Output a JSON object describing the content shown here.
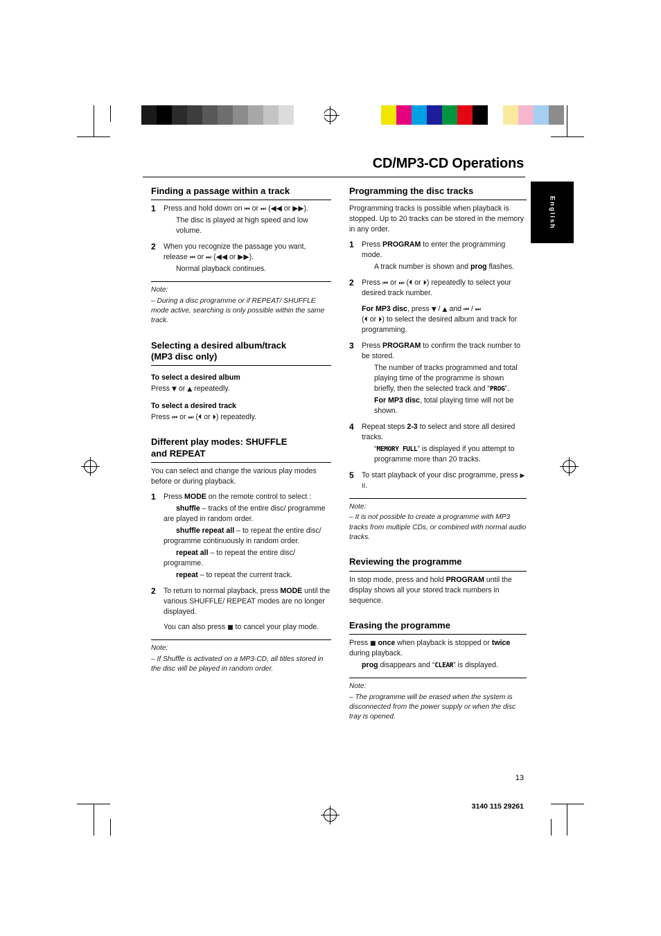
{
  "page": {
    "title": "CD/MP3-CD Operations",
    "language_tab": "English",
    "page_number": "13",
    "doc_code": "3140 115 29261"
  },
  "print_marks": {
    "grayscale_swatches": [
      "#ffffff",
      "#1a1a1a",
      "#000000",
      "#2b2b2b",
      "#3d3d3d",
      "#585858",
      "#6e6e6e",
      "#8c8c8c",
      "#a8a8a8",
      "#c4c4c4",
      "#dcdcdc",
      "#ffffff",
      "#ffffff"
    ],
    "color_swatches": [
      "#ffffff",
      "#f2e500",
      "#e6007e",
      "#00a0e3",
      "#1d1d9c",
      "#009640",
      "#e30613",
      "#000000",
      "#ffffff",
      "#fbe9a0",
      "#f6b6cf",
      "#a4cff0",
      "#8c8c8c"
    ]
  },
  "left_column": {
    "section1": {
      "heading": "Finding a passage within a track",
      "steps": [
        {
          "num": "1",
          "line1_pre": "Press and hold down on ",
          "line1_glyph1": "⏮",
          "line1_mid": " or ",
          "line1_glyph2": "⏭",
          "line1_paren": " (◀◀ or ▶▶).",
          "sub": "The disc is played at high speed and low volume."
        },
        {
          "num": "2",
          "line1_pre": "When you recognize the passage you want, release ",
          "line1_glyph1": "⏮",
          "line1_mid": " or ",
          "line1_glyph2": "⏭",
          "line1_paren": " (◀◀ or ▶▶).",
          "sub": "Normal playback continues."
        }
      ],
      "note_label": "Note:",
      "note_text": "–  During a disc programme or if REPEAT/ SHUFFLE mode active, searching is only possible within the same track."
    },
    "section2": {
      "heading_line1": "Selecting a desired album/track",
      "heading_line2": "(MP3 disc only)",
      "sub1_title": "To select a desired album",
      "sub1_text_pre": "Press ",
      "sub1_glyph1": "▼",
      "sub1_mid": " or ",
      "sub1_glyph2": "▲",
      "sub1_post": "  repeatedly.",
      "sub2_title": "To select a desired track",
      "sub2_text_pre": "Press ",
      "sub2_glyph1": "⏮",
      "sub2_mid": " or ",
      "sub2_glyph2": "⏭",
      "sub2_post": " (⏴ or ⏵) repeatedly."
    },
    "section3": {
      "heading_line1": "Different play modes: SHUFFLE",
      "heading_line2": "and REPEAT",
      "intro": "You can select and change the various play modes before or during playback.",
      "steps": [
        {
          "num": "1",
          "lead": "Press ",
          "lead_bold": "MODE",
          "lead_post": " on the remote control to select :",
          "items": [
            {
              "bold": "shuffle",
              "text": " – tracks of the entire disc/ programme are played in random order."
            },
            {
              "bold": "shuffle repeat all",
              "text": " – to repeat the entire disc/ programme continuously in random order."
            },
            {
              "bold": "repeat all",
              "text": " – to repeat the entire disc/ programme."
            },
            {
              "bold": "repeat",
              "text": " – to repeat the current track."
            }
          ]
        },
        {
          "num": "2",
          "text_pre": "To return to normal playback, press ",
          "text_bold": "MODE",
          "text_post": " until the various SHUFFLE/ REPEAT modes are no longer displayed.",
          "extra_pre": "You can also press ",
          "extra_glyph": "■",
          "extra_post": " to cancel your play mode."
        }
      ],
      "note_label": "Note:",
      "note_text": "–  If Shuffle is activated on a MP3-CD, all titles stored in the disc will be played in random order."
    }
  },
  "right_column": {
    "section1": {
      "heading": "Programming the disc tracks",
      "intro": "Programming tracks is possible when playback is stopped. Up to 20 tracks can be stored in the memory in any order.",
      "steps": [
        {
          "num": "1",
          "text_pre": "Press ",
          "text_bold": "PROGRAM",
          "text_post": " to enter the programming mode.",
          "sub_pre": "A track number is shown and ",
          "sub_bold": "prog",
          "sub_post": " flashes."
        },
        {
          "num": "2",
          "text_pre": "Press ",
          "glyph1": "⏮",
          "mid": " or ",
          "glyph2": "⏭",
          "paren": " (⏴ or ⏵) repeatedly to select your desired track number.",
          "para2_bold": "For MP3 disc",
          "para2_pre": ", press ",
          "para2_g1": "▼",
          "para2_m1": " / ",
          "para2_g2": "▲",
          "para2_m2": " and ",
          "para2_g3": "⏮",
          "para2_m3": " / ",
          "para2_g4": "⏭",
          "para2_post": "(⏴ or ⏵) to select the desired album and track for programming."
        },
        {
          "num": "3",
          "text_pre": "Press ",
          "text_bold": "PROGRAM",
          "text_post": " to confirm the track number to be stored.",
          "sub1_pre": "The number of tracks programmed and total playing time of the programme is shown briefly, then the selected track and “",
          "sub1_lcd": "PROG",
          "sub1_post": "”.",
          "sub2_bold": "For MP3 disc",
          "sub2_post": ", total playing time will not be shown."
        },
        {
          "num": "4",
          "text_pre": "Repeat steps ",
          "text_bold": "2-3",
          "text_post": " to select and store all desired tracks.",
          "sub_pre": "“",
          "sub_lcd": "MEMORY FULL",
          "sub_post": "” is displayed if you attempt to programme more than 20 tracks."
        },
        {
          "num": "5",
          "text_pre": "To start playback of your disc programme, press ",
          "glyph": "▶ II",
          "text_post": "."
        }
      ],
      "note_label": "Note:",
      "note_text": "–  It is not possible to create a programme with MP3 tracks from multiple CDs, or combined with normal audio tracks."
    },
    "section2": {
      "heading": "Reviewing the programme",
      "text_pre": "In stop mode, press and hold ",
      "text_bold": "PROGRAM",
      "text_post": " until the display shows all your stored track numbers in sequence."
    },
    "section3": {
      "heading": "Erasing the programme",
      "text_pre": "Press ",
      "glyph": "■",
      "text_bold1": "once",
      "text_mid": " when playback is stopped or ",
      "text_bold2": "twice",
      "text_post": " during playback.",
      "sub_bold": "prog",
      "sub_mid": " disappears and “",
      "sub_lcd": "CLEAR",
      "sub_post": "” is displayed.",
      "note_label": "Note:",
      "note_text": "–  The programme will be erased when the system is disconnected from the power supply or when the disc tray is opened."
    }
  }
}
